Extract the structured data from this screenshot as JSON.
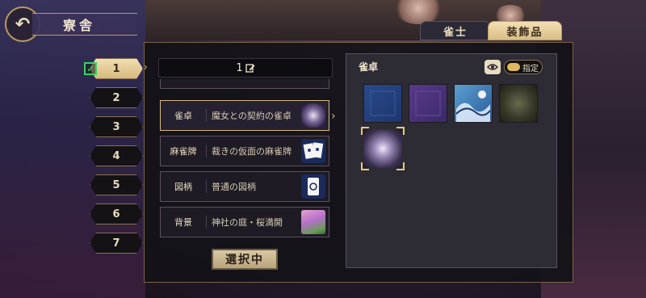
{
  "header": {
    "title": "寮舎",
    "back_icon": "back-arrow-icon"
  },
  "tabs": [
    {
      "label": "雀士",
      "active": false
    },
    {
      "label": "装飾品",
      "active": true
    }
  ],
  "slots": [
    {
      "label": "1",
      "active": true,
      "checked": true
    },
    {
      "label": "2"
    },
    {
      "label": "3"
    },
    {
      "label": "4"
    },
    {
      "label": "5"
    },
    {
      "label": "6"
    },
    {
      "label": "7"
    }
  ],
  "preset": {
    "name": "1"
  },
  "items": [
    {
      "category": "雀卓",
      "name": "魔女との契約の雀卓",
      "selected": true
    },
    {
      "category": "麻雀牌",
      "name": "裁きの仮面の麻雀牌"
    },
    {
      "category": "図柄",
      "name": "普通の図柄"
    },
    {
      "category": "背景",
      "name": "神社の庭・桜満開"
    }
  ],
  "select_button": {
    "label": "選択中"
  },
  "panel": {
    "title": "雀卓",
    "toggle_label": "指定",
    "tiles": [
      "blue-pattern",
      "purple-pattern",
      "wave-pattern",
      "dark-forest",
      "witch-contract"
    ]
  },
  "colors": {
    "gold": "#d6b97f",
    "panel": "#2d2b34",
    "check": "#3bd06b"
  }
}
